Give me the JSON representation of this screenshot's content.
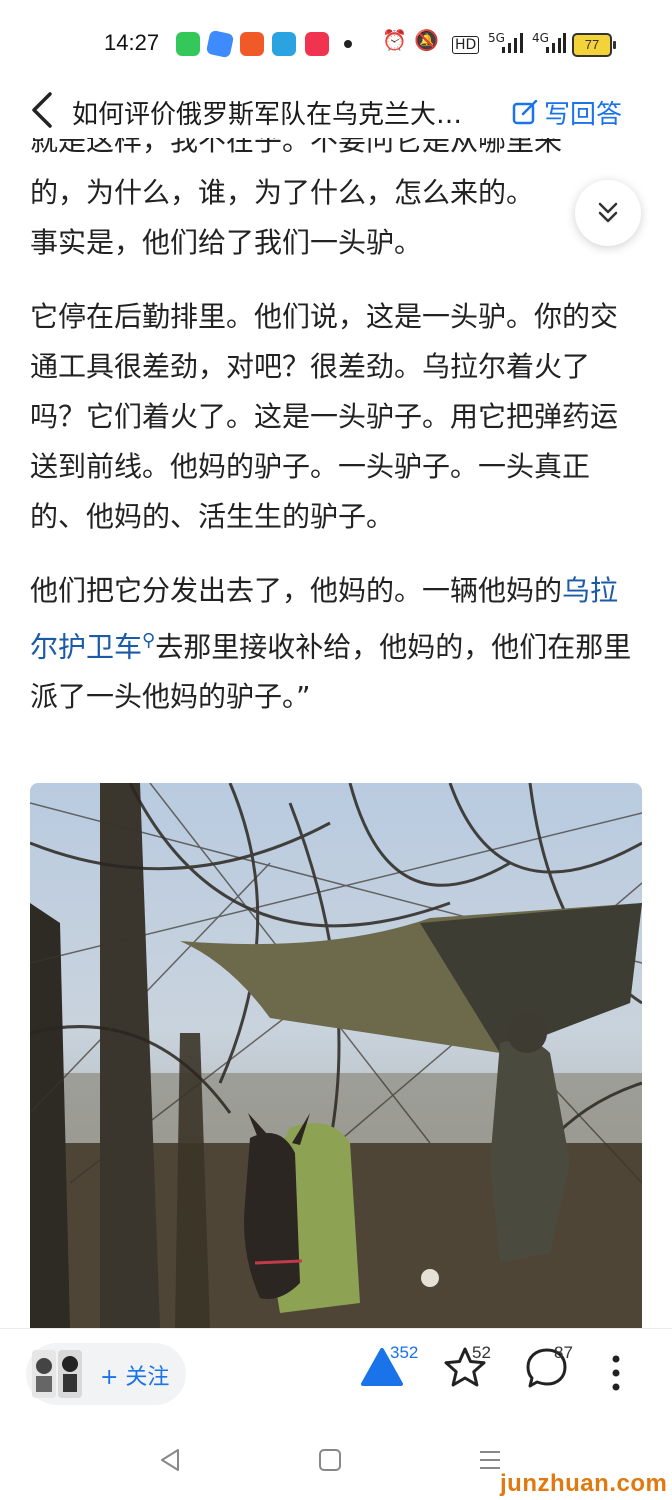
{
  "status_bar": {
    "time": "14:27",
    "network_5g": "5G",
    "network_4g": "4G",
    "hd_label": "HD",
    "battery": "77",
    "icons": [
      "messages-app-icon",
      "browser-icon",
      "video-app-icon",
      "telegram-icon",
      "music-app-icon",
      "alarm-icon",
      "mute-icon",
      "signal-icon"
    ]
  },
  "header": {
    "title": "如何评价俄罗斯军队在乌克兰大…",
    "answer_label": "写回答"
  },
  "article": {
    "p1_clipped": "就是这样，我不在乎。不要问它是从哪里来",
    "p1_line2": "的，为什么，谁，为了什么，怎么来的。",
    "p1_line3": "事实是，他们给了我们一头驴。",
    "p2": "它停在后勤排里。他们说，这是一头驴。你的交通工具很差劲，对吧？很差劲。乌拉尔着火了吗？它们着火了。这是一头驴子。用它把弹药运送到前线。他妈的驴子。一头驴子。一头真正的、他妈的、活生生的驴子。",
    "p3_before": "他们把它分发出去了，他妈的。一辆他妈的",
    "p3_link": "乌拉尔护卫车",
    "p3_after": "去那里接收补给，他妈的，他们在那里派了一头他妈的驴子。”"
  },
  "photo": {
    "description_icon": "donkey-photo"
  },
  "action_bar": {
    "follow_label": "+ 关注",
    "upvotes": "352",
    "favorites": "52",
    "comments": "87"
  },
  "watermark": "junzhuan.com",
  "colors": {
    "accent": "#1a73e8",
    "link": "#1a5aa6",
    "watermark": "#e07a10"
  }
}
